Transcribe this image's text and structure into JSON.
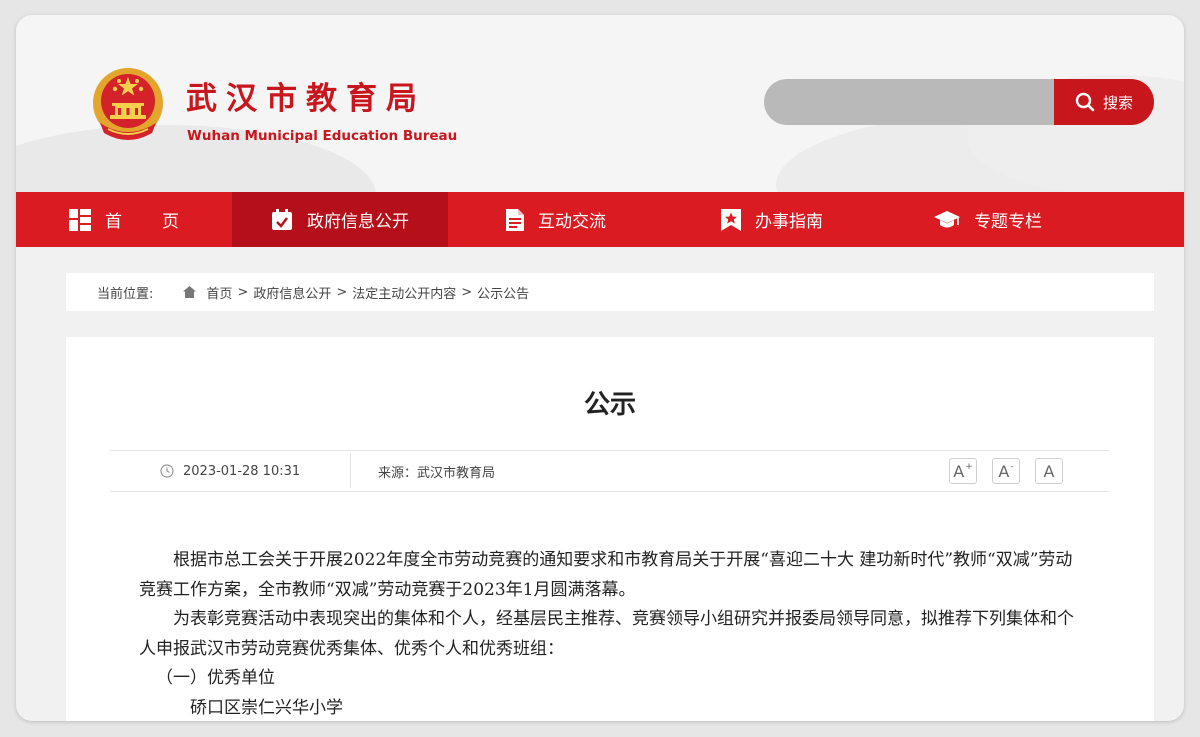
{
  "header": {
    "title": "武汉市教育局",
    "subtitle": "Wuhan Municipal Education Bureau",
    "logo_icon": "national-emblem-icon"
  },
  "search": {
    "placeholder": "",
    "button_label": "搜索",
    "icon": "search-icon"
  },
  "nav": {
    "items": [
      {
        "label": "首页",
        "icon": "grid-icon",
        "active": false
      },
      {
        "label": "政府信息公开",
        "icon": "calendar-check-icon",
        "active": true
      },
      {
        "label": "互动交流",
        "icon": "document-icon",
        "active": false
      },
      {
        "label": "办事指南",
        "icon": "bookmark-star-icon",
        "active": false
      },
      {
        "label": "专题专栏",
        "icon": "graduation-cap-icon",
        "active": false
      }
    ]
  },
  "breadcrumb": {
    "label": "当前位置:",
    "items": [
      "首页",
      "政府信息公开",
      "法定主动公开内容",
      "公示公告"
    ],
    "separator": ">"
  },
  "article": {
    "title": "公示",
    "date": "2023-01-28 10:31",
    "source": "来源：武汉市教育局",
    "font_buttons": [
      "A+",
      "A-",
      "A"
    ],
    "paragraphs": [
      "根据市总工会关于开展2022年度全市劳动竞赛的通知要求和市教育局关于开展“喜迎二十大 建功新时代”教师“双减”劳动竞赛工作方案，全市教师“双减”劳动竞赛于2023年1月圆满落幕。",
      "为表彰竞赛活动中表现突出的集体和个人，经基层民主推荐、竞赛领导小组研究并报委局领导同意，拟推荐下列集体和个人申报武汉市劳动竞赛优秀集体、优秀个人和优秀班组："
    ],
    "section_heading": "（一）优秀单位",
    "list_items": [
      "硚口区崇仁兴华小学"
    ]
  },
  "colors": {
    "brand_red": "#c8161d",
    "nav_red": "#db1b22",
    "nav_active": "#b5101a"
  }
}
